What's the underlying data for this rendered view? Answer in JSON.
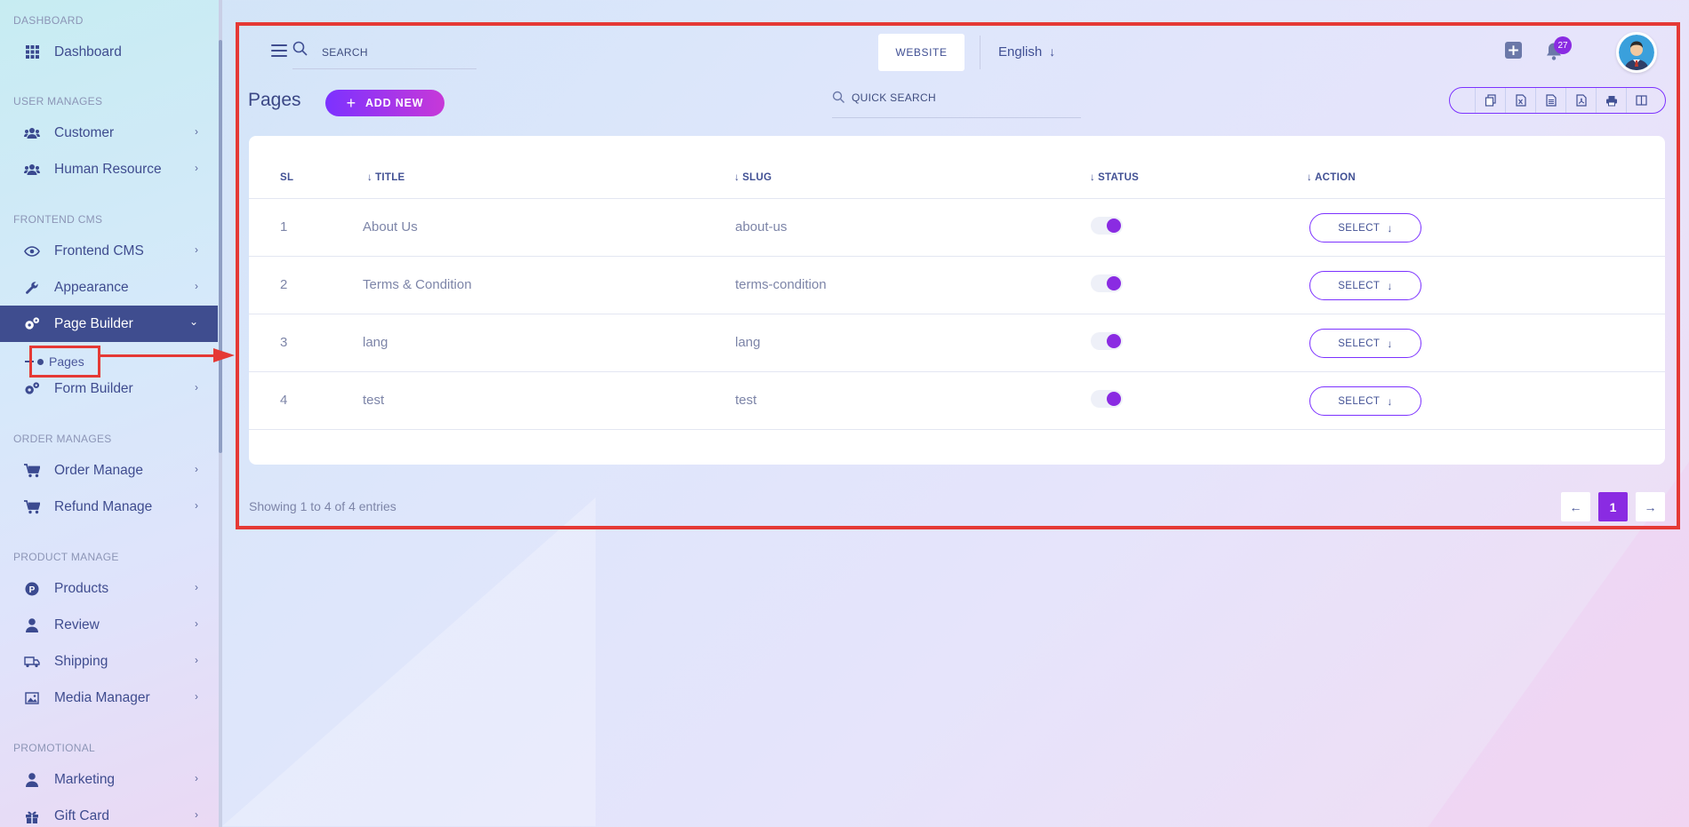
{
  "sidebar": {
    "sections": [
      {
        "title": "DASHBOARD"
      },
      {
        "title": "USER MANAGES"
      },
      {
        "title": "FRONTEND CMS"
      },
      {
        "title": "ORDER MANAGES"
      },
      {
        "title": "PRODUCT MANAGE"
      },
      {
        "title": "PROMOTIONAL"
      }
    ],
    "items": [
      {
        "label": "Dashboard",
        "icon": "grid-icon"
      },
      {
        "label": "Customer",
        "icon": "users-icon"
      },
      {
        "label": "Human Resource",
        "icon": "users-icon"
      },
      {
        "label": "Frontend CMS",
        "icon": "eye-icon"
      },
      {
        "label": "Appearance",
        "icon": "wrench-icon"
      },
      {
        "label": "Page Builder",
        "icon": "gears-icon"
      },
      {
        "label": "Form Builder",
        "icon": "gears-icon"
      },
      {
        "label": "Order Manage",
        "icon": "cart-icon"
      },
      {
        "label": "Refund Manage",
        "icon": "cart-icon"
      },
      {
        "label": "Products",
        "icon": "product-icon"
      },
      {
        "label": "Review",
        "icon": "user-icon"
      },
      {
        "label": "Shipping",
        "icon": "truck-icon"
      },
      {
        "label": "Media Manager",
        "icon": "image-icon"
      },
      {
        "label": "Marketing",
        "icon": "user-icon"
      },
      {
        "label": "Gift Card",
        "icon": "gift-icon"
      }
    ],
    "sub_item": {
      "label": "Pages"
    }
  },
  "header": {
    "search_placeholder": "SEARCH",
    "website_label": "WEBSITE",
    "language": "English",
    "notification_count": "27"
  },
  "page": {
    "title": "Pages",
    "add_new_label": "ADD NEW",
    "quick_search_placeholder": "QUICK SEARCH"
  },
  "table": {
    "columns": {
      "sl": "SL",
      "title": "TITLE",
      "slug": "SLUG",
      "status": "STATUS",
      "action": "ACTION"
    },
    "rows": [
      {
        "sl": "1",
        "title": "About Us",
        "slug": "about-us",
        "status": true,
        "action": "SELECT"
      },
      {
        "sl": "2",
        "title": "Terms & Condition",
        "slug": "terms-condition",
        "status": true,
        "action": "SELECT"
      },
      {
        "sl": "3",
        "title": "lang",
        "slug": "lang",
        "status": true,
        "action": "SELECT"
      },
      {
        "sl": "4",
        "title": "test",
        "slug": "test",
        "status": true,
        "action": "SELECT"
      }
    ]
  },
  "footer": {
    "showing_text": "Showing 1 to 4 of 4 entries",
    "current_page": "1"
  },
  "colors": {
    "accent": "#7c32ff",
    "accent_end": "#c738d8",
    "sidebar_active": "#3f4d8f",
    "annotation": "#e53935"
  }
}
